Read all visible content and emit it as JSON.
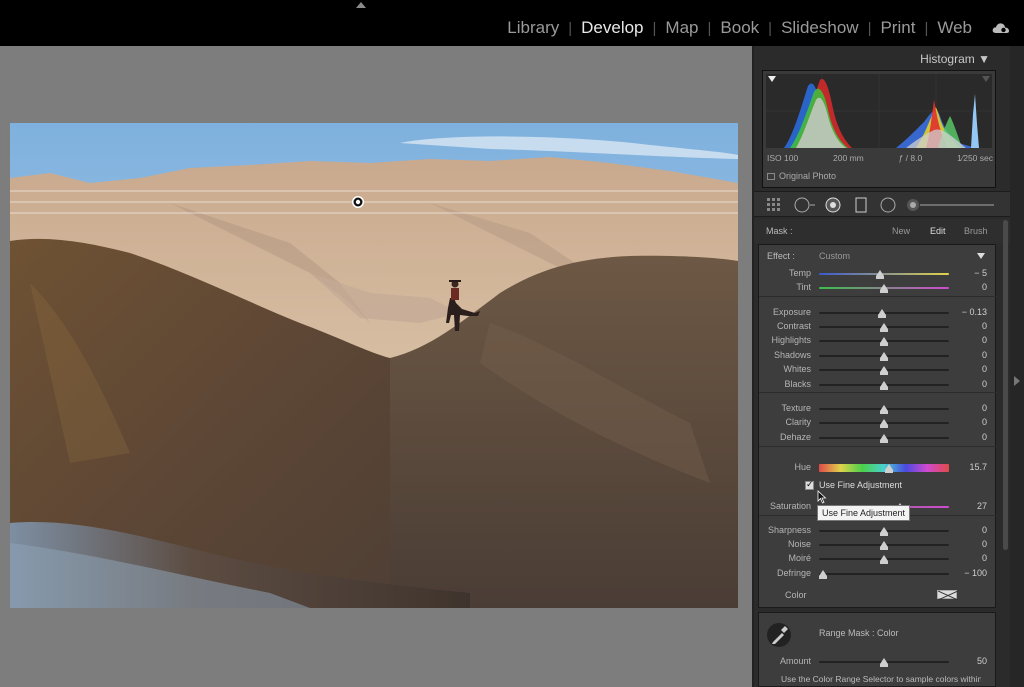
{
  "modules": {
    "items": [
      "Library",
      "Develop",
      "Map",
      "Book",
      "Slideshow",
      "Print",
      "Web"
    ],
    "active_index": 1
  },
  "histogram": {
    "title": "Histogram",
    "iso": "ISO 100",
    "focal": "200 mm",
    "aperture": "ƒ / 8.0",
    "shutter": "1⁄250 sec",
    "original_photo": "Original Photo"
  },
  "mask": {
    "label": "Mask :",
    "new": "New",
    "edit": "Edit",
    "brush": "Brush"
  },
  "effect": {
    "label": "Effect :",
    "value": "Custom"
  },
  "sliders": {
    "temp": {
      "label": "Temp",
      "value": "− 5",
      "pos": 0.47
    },
    "tint": {
      "label": "Tint",
      "value": "0",
      "pos": 0.5
    },
    "exposure": {
      "label": "Exposure",
      "value": "− 0.13",
      "pos": 0.485
    },
    "contrast": {
      "label": "Contrast",
      "value": "0",
      "pos": 0.5
    },
    "highlights": {
      "label": "Highlights",
      "value": "0",
      "pos": 0.5
    },
    "shadows": {
      "label": "Shadows",
      "value": "0",
      "pos": 0.5
    },
    "whites": {
      "label": "Whites",
      "value": "0",
      "pos": 0.5
    },
    "blacks": {
      "label": "Blacks",
      "value": "0",
      "pos": 0.5
    },
    "texture": {
      "label": "Texture",
      "value": "0",
      "pos": 0.5
    },
    "clarity": {
      "label": "Clarity",
      "value": "0",
      "pos": 0.5
    },
    "dehaze": {
      "label": "Dehaze",
      "value": "0",
      "pos": 0.5
    },
    "hue": {
      "label": "Hue",
      "value": "15.7",
      "pos": 0.54
    },
    "saturation": {
      "label": "Saturation",
      "value": "27",
      "pos": 0.62
    },
    "sharpness": {
      "label": "Sharpness",
      "value": "0",
      "pos": 0.5
    },
    "noise": {
      "label": "Noise",
      "value": "0",
      "pos": 0.5
    },
    "moire": {
      "label": "Moiré",
      "value": "0",
      "pos": 0.5
    },
    "defringe": {
      "label": "Defringe",
      "value": "− 100",
      "pos": 0.03
    }
  },
  "fine_adjustment": {
    "label": "Use Fine Adjustment",
    "tooltip": "Use Fine Adjustment"
  },
  "color": {
    "label": "Color"
  },
  "range_mask": {
    "label": "Range Mask : Color",
    "amount_label": "Amount",
    "amount_value": "50",
    "amount_pos": 0.5,
    "description": "Use the Color Range Selector to sample colors within the mask area. Click + drag for greater"
  }
}
